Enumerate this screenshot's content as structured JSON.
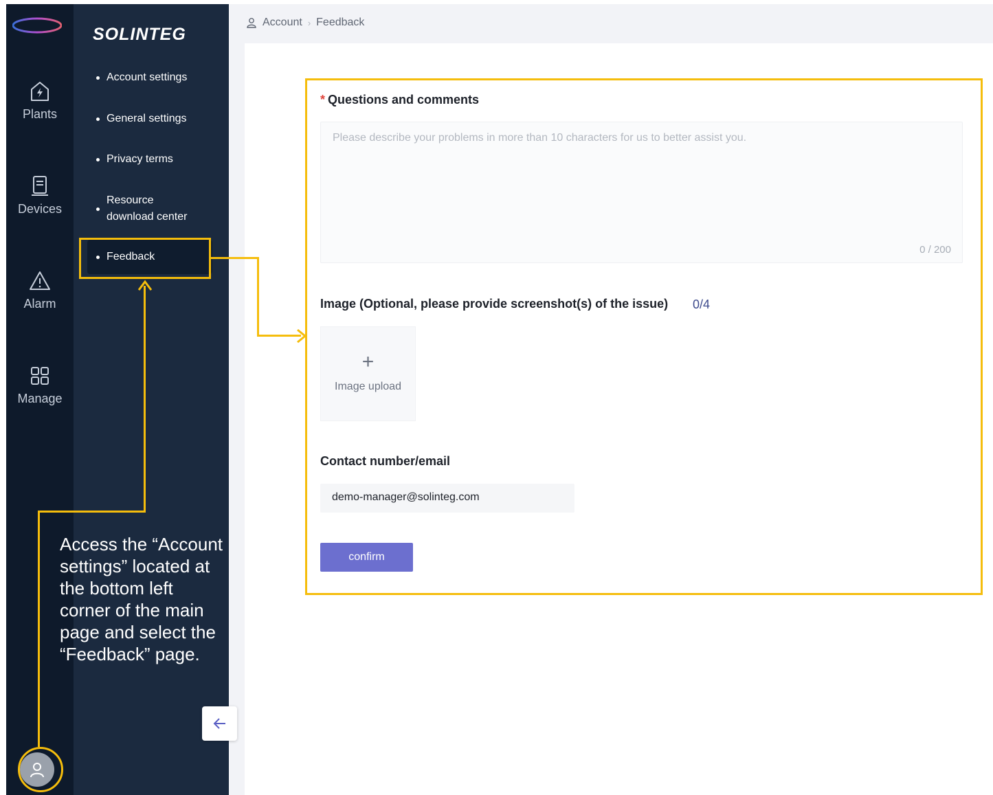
{
  "brand": {
    "name": "SOLINTEG"
  },
  "rail": {
    "items": [
      {
        "label": "Plants",
        "icon": "plant-bolt-icon"
      },
      {
        "label": "Devices",
        "icon": "device-icon"
      },
      {
        "label": "Alarm",
        "icon": "alarm-triangle-icon"
      },
      {
        "label": "Manage",
        "icon": "manage-grid-icon"
      }
    ],
    "avatar_icon": "user-icon"
  },
  "submenu": {
    "items": [
      {
        "label": "Account settings"
      },
      {
        "label": "General settings"
      },
      {
        "label": "Privacy terms"
      },
      {
        "label": "Resource download center"
      },
      {
        "label": "Feedback",
        "active": true
      }
    ],
    "collapse_icon": "arrow-left-icon"
  },
  "breadcrumb": {
    "root": "Account",
    "current": "Feedback",
    "icon": "user-outline-icon"
  },
  "form": {
    "questions_label": "Questions and comments",
    "required_mark": "*",
    "questions_placeholder": "Please describe your problems in more than 10 characters for us to better assist you.",
    "questions_counter": "0 / 200",
    "image_label": "Image (Optional, please provide screenshot(s) of the issue)",
    "image_count": "0/4",
    "upload_label": "Image upload",
    "contact_label": "Contact number/email",
    "contact_value": "demo-manager@solinteg.com",
    "confirm_label": "confirm"
  },
  "annotation": {
    "instruction": "Access the “Account settings” located at the bottom left corner of the main page and select the “Feedback” page.",
    "highlight_color": "#f5bd0c"
  },
  "colors": {
    "rail_bg": "#0e1a2b",
    "submenu_bg": "#1b2a3f",
    "accent_button": "#6c6fcf",
    "required": "#e0443b"
  }
}
